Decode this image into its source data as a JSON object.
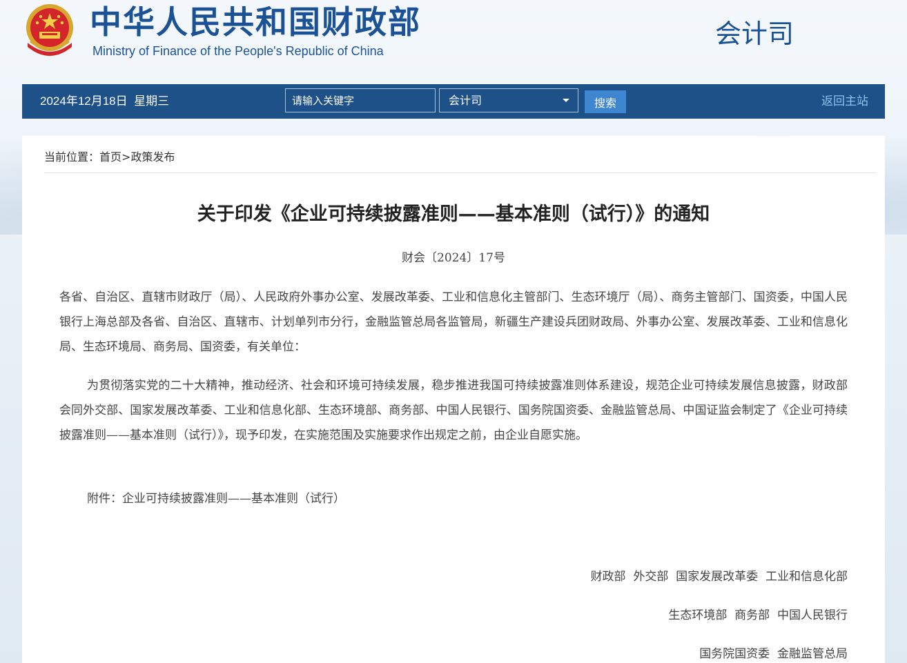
{
  "header": {
    "cn_title": "中华人民共和国财政部",
    "en_title": "Ministry of Finance of the People's Republic of China",
    "department": "会计司",
    "emblem_icon": "national-emblem-icon"
  },
  "navbar": {
    "date": "2024年12月18日",
    "weekday": "星期三",
    "search_placeholder": "请输入关键字",
    "select_value": "会计司",
    "search_button": "搜索",
    "home_link": "返回主站"
  },
  "breadcrumb": {
    "prefix": "当前位置：",
    "home": "首页",
    "separator": ">",
    "current": "政策发布"
  },
  "article": {
    "title": "关于印发《企业可持续披露准则——基本准则（试行）》的通知",
    "doc_number": "财会〔2024〕17号",
    "addressees": "各省、自治区、直辖市财政厅（局）、人民政府外事办公室、发展改革委、工业和信息化主管部门、生态环境厅（局）、商务主管部门、国资委，中国人民银行上海总部及各省、自治区、直辖市、计划单列市分行，金融监管总局各监管局，新疆生产建设兵团财政局、外事办公室、发展改革委、工业和信息化局、生态环境局、商务局、国资委，有关单位：",
    "main_paragraph": "为贯彻落实党的二十大精神，推动经济、社会和环境可持续发展，稳步推进我国可持续披露准则体系建设，规范企业可持续发展信息披露，财政部会同外交部、国家发展改革委、工业和信息化部、生态环境部、商务部、中国人民银行、国务院国资委、金融监管总局、中国证监会制定了《企业可持续披露准则——基本准则（试行）》，现予印发，在实施范围及实施要求作出规定之前，由企业自愿实施。",
    "attachment": "附件：企业可持续披露准则——基本准则（试行）",
    "signatories": [
      "财政部  外交部  国家发展改革委  工业和信息化部",
      "生态环境部  商务部  中国人民银行",
      "国务院国资委  金融监管总局"
    ]
  },
  "colors": {
    "brand_blue": "#1b5296",
    "navbar_bg": "#1e5187",
    "search_button_bg": "#3e86cf",
    "home_link": "#8fc0f0"
  }
}
